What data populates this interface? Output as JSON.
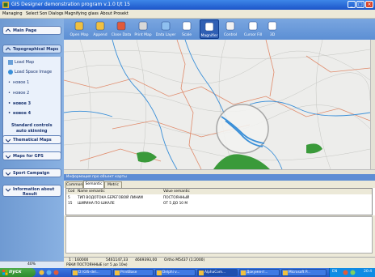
{
  "window": {
    "title": "GIS Designer demonstration program v.1.0 t/t 15",
    "controls": [
      "_",
      "□",
      "×"
    ]
  },
  "menu": {
    "items": [
      "Managing",
      "Select Son Dialogs",
      "Magnifying glass",
      "About Prosekt"
    ]
  },
  "sidebar": {
    "main_page": "Main Page",
    "topo_maps": "Topographical Maps",
    "items": [
      {
        "label": "Load Map",
        "bold": false
      },
      {
        "label": "Load Space Image",
        "bold": false
      },
      {
        "label": "новое 1",
        "bold": false
      },
      {
        "label": "новое 2",
        "bold": false
      },
      {
        "label": "новое 3",
        "bold": true
      },
      {
        "label": "новое 4",
        "bold": true
      }
    ],
    "standard_controls": "Standard controls",
    "auto_skinning": "auto skinning",
    "thematical_maps": "Thematical Maps",
    "maps_gps": "Maps for GPS",
    "sport_campaign": "Sport Campaign",
    "info_about": "Information about",
    "info_result": "Result",
    "progress": "40%"
  },
  "toolbar": {
    "buttons": [
      {
        "label": "Open Map",
        "icon": "folder-icon"
      },
      {
        "label": "Append",
        "icon": "append-icon"
      },
      {
        "label": "Close Data",
        "icon": "close-data-icon"
      },
      {
        "label": "Print Map",
        "icon": "print-icon"
      },
      {
        "label": "Data Layer",
        "icon": "layers-icon"
      },
      {
        "label": "Scale",
        "icon": "scale-icon"
      },
      {
        "label": "Magnifier",
        "icon": "magnifier-icon"
      },
      {
        "label": "Control",
        "icon": "compass-icon"
      },
      {
        "label": "Cursor Fill",
        "icon": "cursor-icon"
      },
      {
        "label": "3D",
        "icon": "3d-icon"
      }
    ]
  },
  "info": {
    "header": "Информация про объект карты",
    "tabs": [
      "Common",
      "Semantic",
      "Metric"
    ],
    "active_tab": 1,
    "columns": [
      "Cod",
      "Name semantic",
      "Value semantic"
    ],
    "rows": [
      {
        "cod": "5",
        "name": "ТИП ВОДОТОКА БЕРЕГОВОЙ ЛИНИИ",
        "value": "ПОСТОЯННЫЙ",
        "selected": false
      },
      {
        "cod": "15",
        "name": "ШИРИНА ПО ШКАЛЕ",
        "value": "ОТ 5 ДО 10 М",
        "selected": false
      }
    ]
  },
  "status": {
    "scale": "1 : 160000",
    "x": "5461147,33",
    "y": "4669393,00",
    "crs": "Ortho M5437 (1:2000)",
    "line2": "РЕКИ ПОСТОЯННЫЕ (от 5 до 10м)",
    "line3": "← Controls accepted by statusbars"
  },
  "taskbar": {
    "start": "пуск",
    "items": [
      "D:\\GIS-del...",
      "PrintBase",
      "Delphi v...",
      "AlphaCom...",
      "Документ...",
      "Microsoft P..."
    ],
    "lang": "EN",
    "time": "20:4"
  },
  "colors": {
    "water": "#3a8fd8",
    "road": "#e08a6a",
    "forest": "#3a9a3a",
    "toolbar": "#5c8fd4"
  }
}
